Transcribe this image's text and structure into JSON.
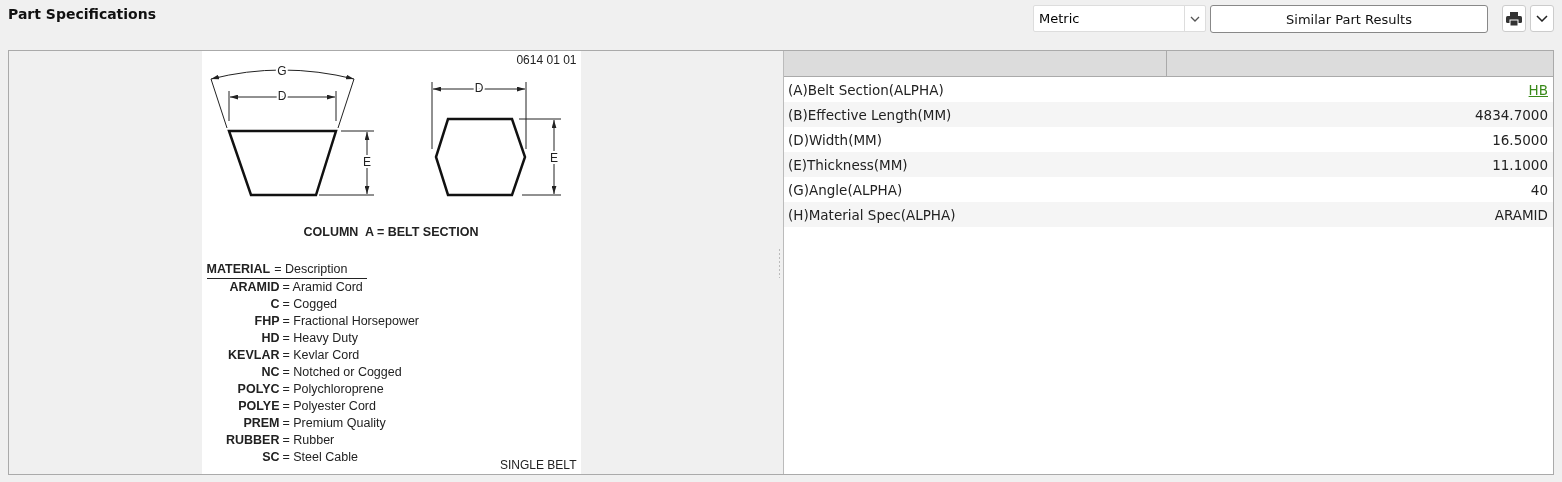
{
  "title": "Part Specifications",
  "toolbar": {
    "unit_select": {
      "value": "Metric"
    },
    "similar_button": "Similar Part Results"
  },
  "drawing": {
    "code": "0614 01 01",
    "labels": {
      "g": "G",
      "d_left": "D",
      "e_left": "E",
      "d_right": "D",
      "e_right": "E"
    },
    "caption": "COLUMN  A = BELT SECTION",
    "legend_header": {
      "code": "MATERIAL",
      "text": "= Description"
    },
    "legend": [
      {
        "code": "ARAMID",
        "text": "= Aramid Cord"
      },
      {
        "code": "C",
        "text": "= Cogged"
      },
      {
        "code": "FHP",
        "text": "= Fractional Horsepower"
      },
      {
        "code": "HD",
        "text": "= Heavy Duty"
      },
      {
        "code": "KEVLAR",
        "text": "= Kevlar Cord"
      },
      {
        "code": "NC",
        "text": "= Notched or Cogged"
      },
      {
        "code": "POLYC",
        "text": "= Polychloroprene"
      },
      {
        "code": "POLYE",
        "text": "= Polyester Cord"
      },
      {
        "code": "PREM",
        "text": "= Premium Quality"
      },
      {
        "code": "RUBBER",
        "text": "= Rubber"
      },
      {
        "code": "SC",
        "text": "= Steel Cable"
      }
    ],
    "footer": "SINGLE BELT"
  },
  "table": {
    "rows": [
      {
        "name": "(A)Belt Section(ALPHA)",
        "value": "HB",
        "kind": "link"
      },
      {
        "name": "(B)Effective Length(MM)",
        "value": "4834.7000",
        "kind": "text"
      },
      {
        "name": "(D)Width(MM)",
        "value": "16.5000",
        "kind": "text"
      },
      {
        "name": "(E)Thickness(MM)",
        "value": "11.1000",
        "kind": "text"
      },
      {
        "name": "(G)Angle(ALPHA)",
        "value": "40",
        "kind": "text"
      },
      {
        "name": "(H)Material Spec(ALPHA)",
        "value": "ARAMID",
        "kind": "text"
      }
    ]
  }
}
